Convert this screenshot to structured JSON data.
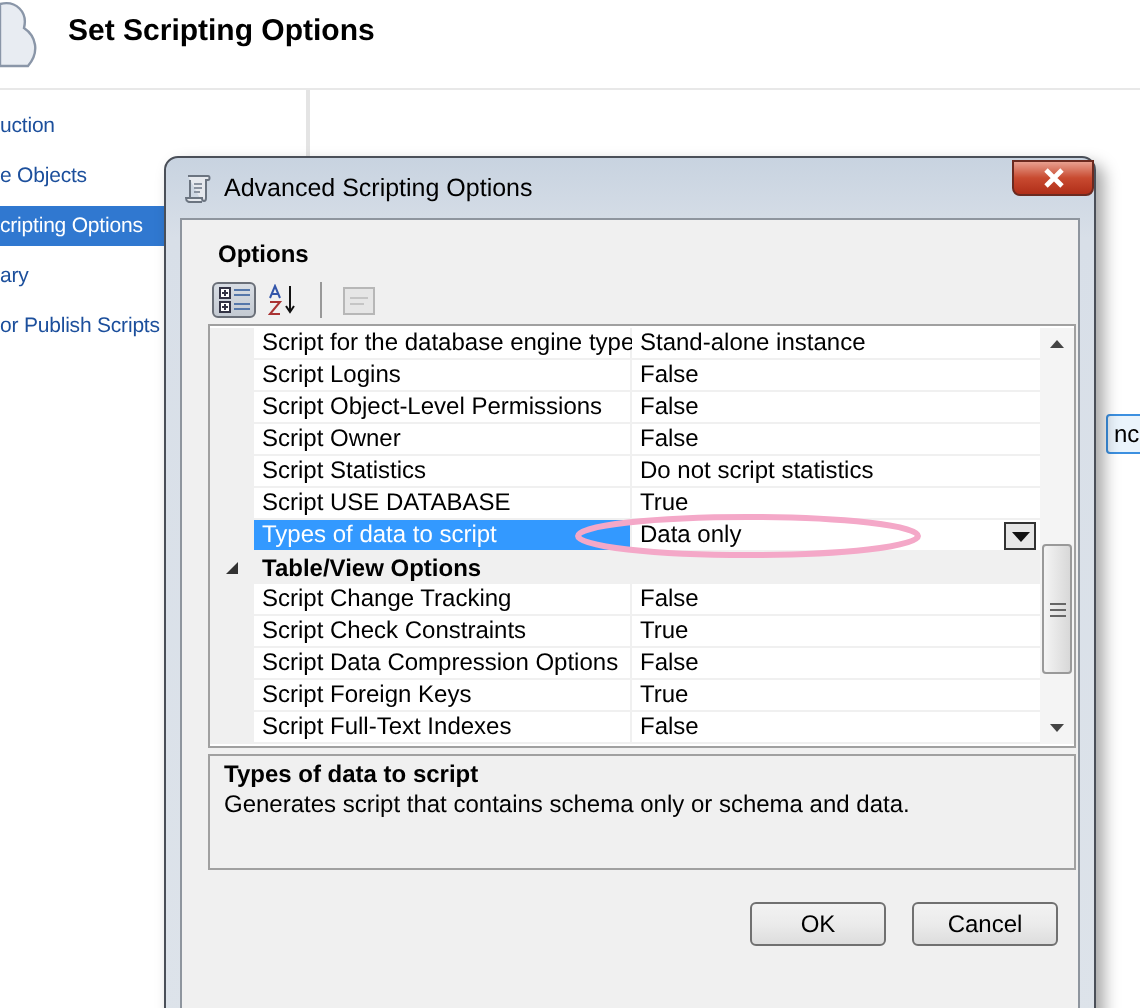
{
  "wizard": {
    "title": "Set Scripting Options",
    "steps": [
      {
        "label": "uction",
        "selected": false
      },
      {
        "label": "e Objects",
        "selected": false
      },
      {
        "label": "cripting Options",
        "selected": true
      },
      {
        "label": "ary",
        "selected": false
      },
      {
        "label": "or Publish Scripts",
        "selected": false
      }
    ],
    "partial_button": "nc"
  },
  "dialog": {
    "title": "Advanced Scripting Options",
    "heading": "Options",
    "toolbar": [
      {
        "kind": "categorized",
        "selected": true
      },
      {
        "kind": "alphabetical",
        "selected": false
      },
      {
        "kind": "separator"
      },
      {
        "kind": "pages",
        "disabled": true
      }
    ],
    "properties": [
      {
        "kind": "property",
        "name": "Script for the database engine type",
        "value": "Stand-alone instance",
        "selected": false
      },
      {
        "kind": "property",
        "name": "Script Logins",
        "value": "False",
        "selected": false
      },
      {
        "kind": "property",
        "name": "Script Object-Level Permissions",
        "value": "False",
        "selected": false
      },
      {
        "kind": "property",
        "name": "Script Owner",
        "value": "False",
        "selected": false
      },
      {
        "kind": "property",
        "name": "Script Statistics",
        "value": "Do not script statistics",
        "selected": false
      },
      {
        "kind": "property",
        "name": "Script USE DATABASE",
        "value": "True",
        "selected": false
      },
      {
        "kind": "property",
        "name": "Types of data to script",
        "value": "Data only",
        "selected": true,
        "circled": true
      },
      {
        "kind": "category",
        "name": "Table/View Options",
        "expanded": true
      },
      {
        "kind": "property",
        "name": "Script Change Tracking",
        "value": "False",
        "selected": false
      },
      {
        "kind": "property",
        "name": "Script Check Constraints",
        "value": "True",
        "selected": false
      },
      {
        "kind": "property",
        "name": "Script Data Compression Options",
        "value": "False",
        "selected": false
      },
      {
        "kind": "property",
        "name": "Script Foreign Keys",
        "value": "True",
        "selected": false
      },
      {
        "kind": "property",
        "name": "Script Full-Text Indexes",
        "value": "False",
        "selected": false
      }
    ],
    "description": {
      "title": "Types of data to script",
      "text": "Generates script that contains schema only or schema and data."
    },
    "buttons": [
      "OK",
      "Cancel"
    ]
  }
}
